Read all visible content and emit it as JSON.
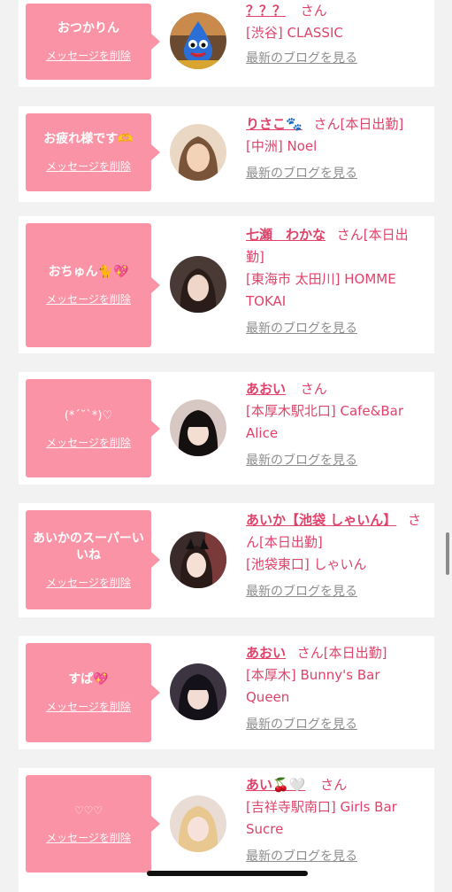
{
  "colors": {
    "background": "#f2f2f2",
    "card": "#ffffff",
    "bubble": "#fb93a6",
    "accent": "#e0426a",
    "link_gray": "#8d8d8d"
  },
  "delete_label": "メッセージを削除",
  "blog_label": "最新のブログを見る",
  "items": [
    {
      "message": "おつかりん",
      "name": "？？？",
      "suffix": "さん",
      "shop": "[渋谷] CLASSIC",
      "avatar_icon": "slime-avatar"
    },
    {
      "message": "お疲れ様です🫶",
      "name": "りさこ🐾",
      "suffix": "さん[本日出勤]",
      "shop": "[中洲] Noel",
      "avatar_icon": "girl-avatar"
    },
    {
      "message": "おちゅん🐈💖",
      "name": "七瀬　わかな",
      "suffix": "さん[本日出勤]",
      "shop": "[東海市 太田川] HOMME TOKAI",
      "avatar_icon": "girl-avatar"
    },
    {
      "message": "(*´˘`*)♡",
      "name": "あおい",
      "suffix": "さん",
      "shop": "[本厚木駅北口] Cafe&Bar Alice",
      "avatar_icon": "girl-avatar"
    },
    {
      "message": "あいかのスーパーいいね",
      "name": "あいか【池袋 しゃいん】",
      "suffix": "さん[本日出勤]",
      "shop": "[池袋東口] しゃいん",
      "avatar_icon": "girl-avatar"
    },
    {
      "message": "すぱ💖",
      "name": "あおい",
      "suffix": "さん[本日出勤]",
      "shop": "[本厚木] Bunny's Bar Queen",
      "avatar_icon": "girl-avatar"
    },
    {
      "message": "♡♡♡",
      "name": "あい🍒🤍",
      "suffix": "さん",
      "shop": "[吉祥寺駅南口] Girls Bar Sucre",
      "avatar_icon": "girl-avatar"
    }
  ]
}
